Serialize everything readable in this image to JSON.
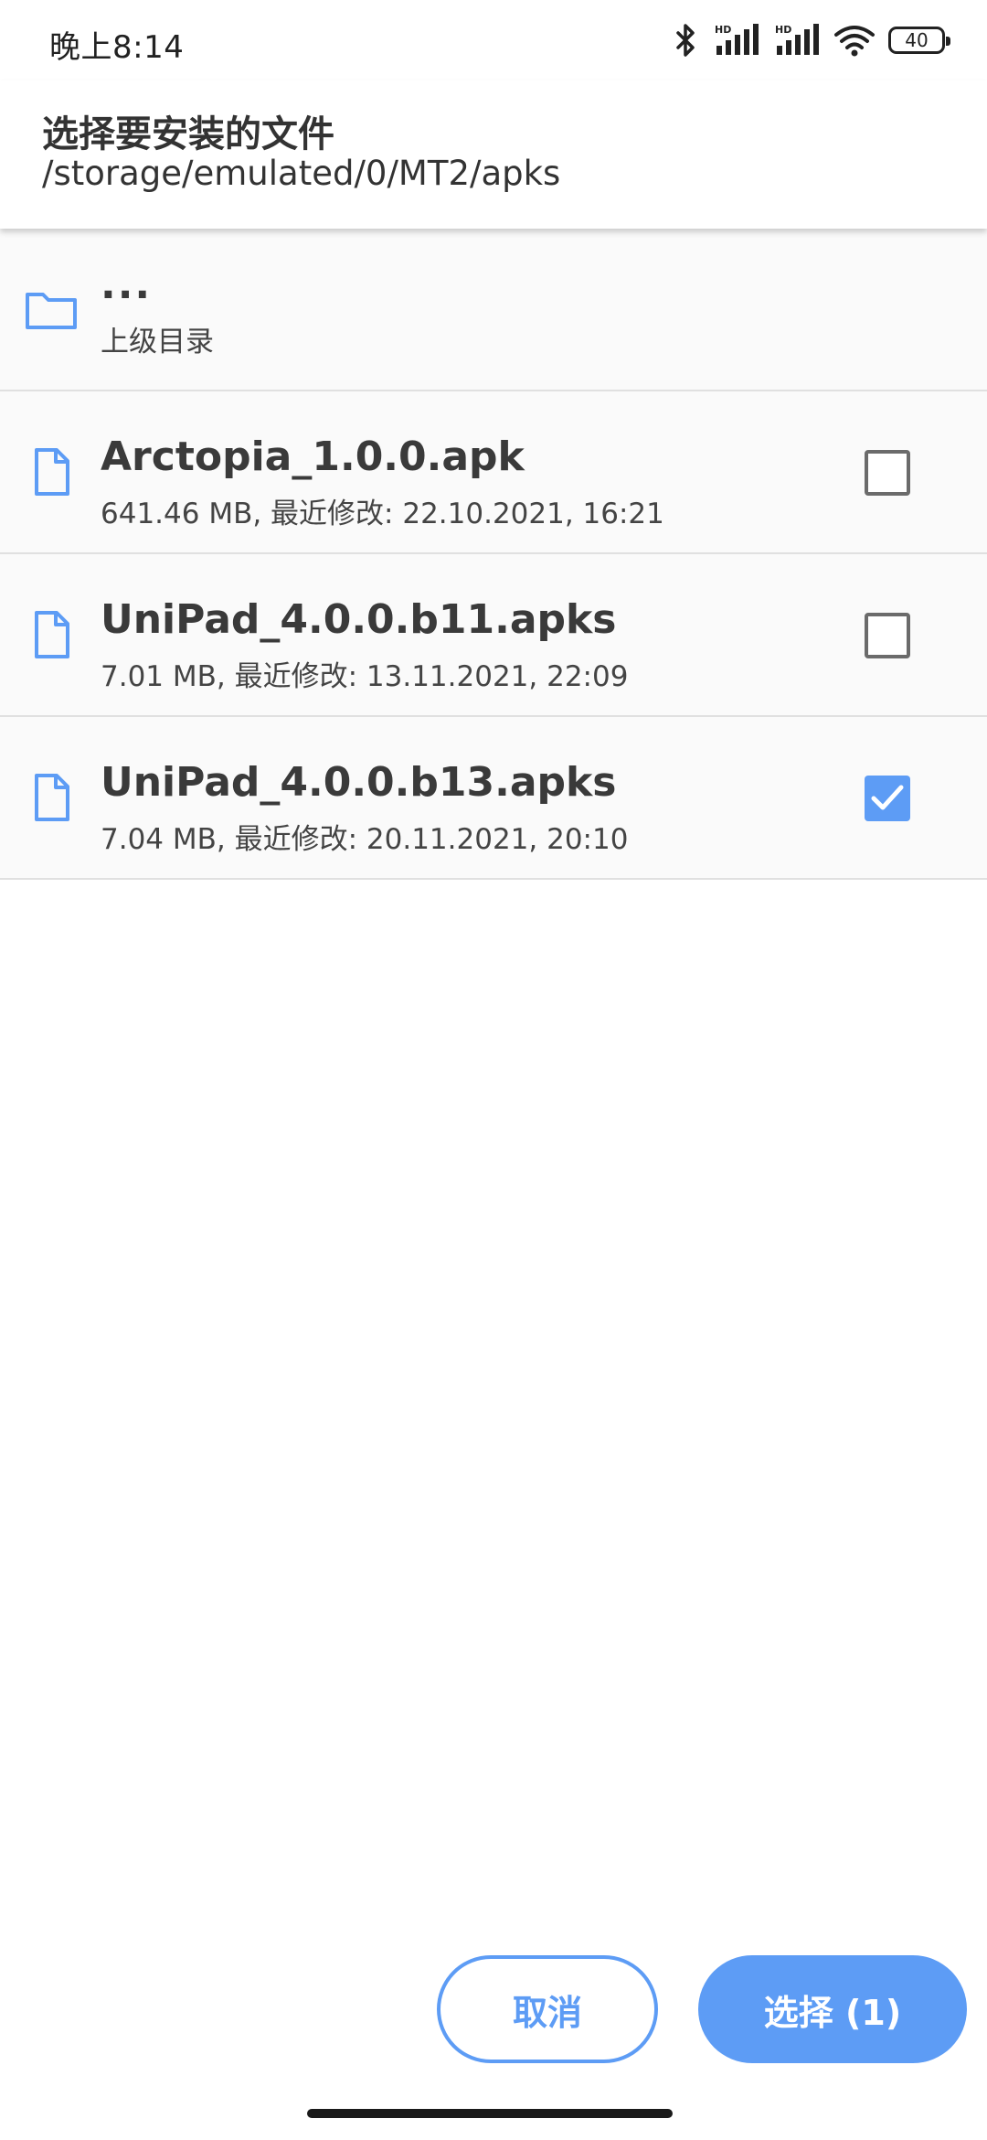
{
  "status_bar": {
    "time": "晚上8:14",
    "battery": "40",
    "icons": [
      "bluetooth-icon",
      "hd-signal-icon",
      "hd-signal-icon",
      "wifi-icon",
      "battery-icon"
    ]
  },
  "header": {
    "title": "选择要安装的文件",
    "path": "/storage/emulated/0/MT2/apks"
  },
  "parent_dir": {
    "name": "...",
    "label": "上级目录",
    "icon": "folder-icon"
  },
  "files": [
    {
      "name": "Arctopia_1.0.0.apk",
      "meta": "641.46 MB, 最近修改: 22.10.2021, 16:21",
      "checked": false,
      "icon": "file-icon"
    },
    {
      "name": "UniPad_4.0.0.b11.apks",
      "meta": "7.01 MB, 最近修改: 13.11.2021, 22:09",
      "checked": false,
      "icon": "file-icon"
    },
    {
      "name": "UniPad_4.0.0.b13.apks",
      "meta": "7.04 MB, 最近修改: 20.11.2021, 20:10",
      "checked": true,
      "icon": "file-icon"
    }
  ],
  "buttons": {
    "cancel": "取消",
    "select": "选择 (1)"
  },
  "colors": {
    "accent": "#5d9cf5",
    "checkbox_unchecked": "#6b6b6b"
  }
}
